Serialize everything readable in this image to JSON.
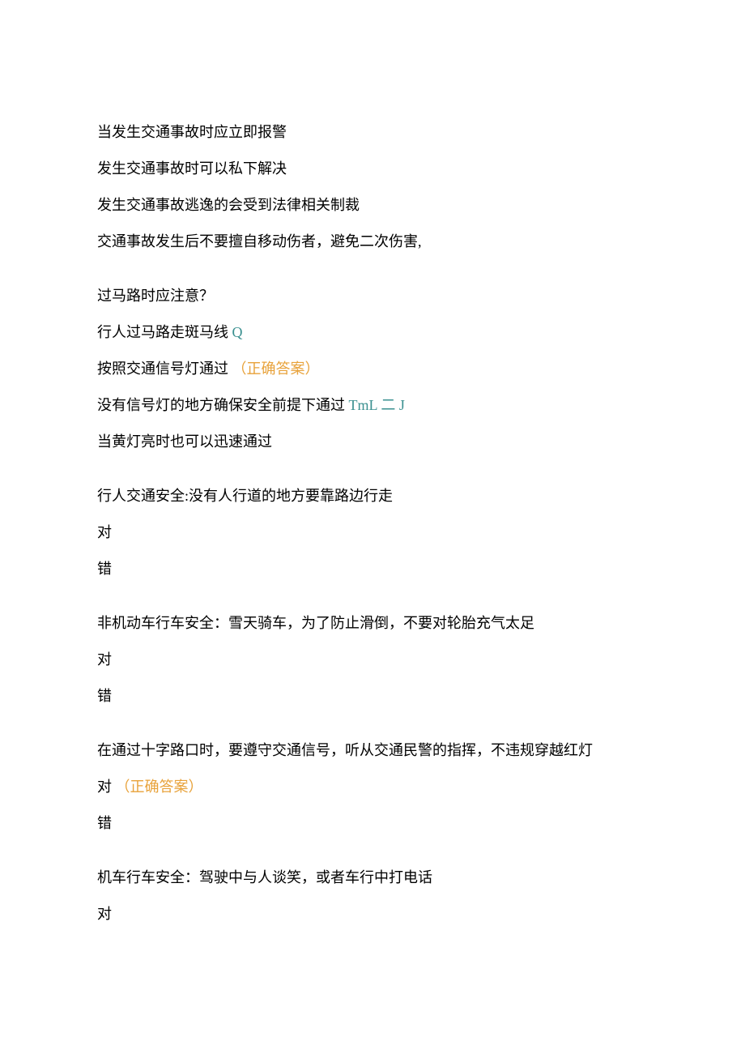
{
  "lines": {
    "l1": "当发生交通事故时应立即报警",
    "l2": "发生交通事故时可以私下解决",
    "l3": "发生交通事故逃逸的会受到法律相关制裁",
    "l4": "交通事故发生后不要擅自移动伤者，避免二次伤害,",
    "q1": "过马路时应注意？",
    "q1o1": "行人过马路走斑马线",
    "q1o1_suffix": " Q",
    "q1o2": "按照交通信号灯通过",
    "correct_label": " （正确答案）",
    "q1o3": "没有信号灯的地方确保安全前提下通过",
    "q1o3_suffix": " TmL 二 J",
    "q1o4": "当黄灯亮时也可以迅速通过",
    "q2": "行人交通安全:没有人行道的地方要靠路边行走",
    "true_label": "对",
    "false_label": "错",
    "q3": "非机动车行车安全：雪天骑车，为了防止滑倒，不要对轮胎充气太足",
    "q4": "在通过十字路口时，要遵守交通信号，听从交通民警的指挥，不违规穿越红灯",
    "q5": "机车行车安全：驾驶中与人谈笑，或者车行中打电话"
  }
}
